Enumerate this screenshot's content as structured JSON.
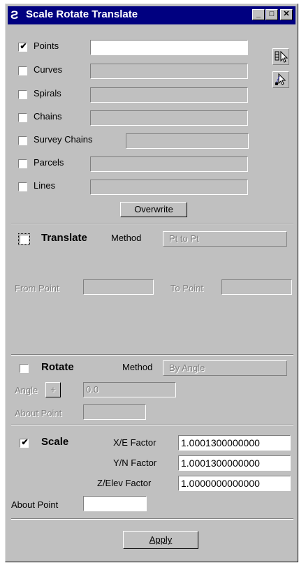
{
  "window": {
    "title": "Scale Rotate Translate"
  },
  "selection": {
    "items": [
      {
        "label": "Points",
        "checked": true,
        "value": ""
      },
      {
        "label": "Curves",
        "checked": false,
        "value": ""
      },
      {
        "label": "Spirals",
        "checked": false,
        "value": ""
      },
      {
        "label": "Chains",
        "checked": false,
        "value": ""
      },
      {
        "label": "Survey Chains",
        "checked": false,
        "value": ""
      },
      {
        "label": "Parcels",
        "checked": false,
        "value": ""
      },
      {
        "label": "Lines",
        "checked": false,
        "value": ""
      }
    ],
    "overwrite_label": "Overwrite"
  },
  "translate": {
    "label": "Translate",
    "checked": false,
    "method_label": "Method",
    "method_value": "Pt to Pt",
    "from_point_label": "From Point",
    "from_point_value": "",
    "to_point_label": "To Point",
    "to_point_value": ""
  },
  "rotate": {
    "label": "Rotate",
    "checked": false,
    "method_label": "Method",
    "method_value": "By Angle",
    "angle_label": "Angle",
    "angle_sign": "+",
    "angle_value": "0.0",
    "about_point_label": "About Point",
    "about_point_value": ""
  },
  "scale": {
    "label": "Scale",
    "checked": true,
    "xe_label": "X/E Factor",
    "xe_value": "1.0001300000000",
    "yn_label": "Y/N Factor",
    "yn_value": "1.0001300000000",
    "ze_label": "Z/Elev Factor",
    "ze_value": "1.0000000000000",
    "about_point_label": "About Point",
    "about_point_value": ""
  },
  "apply_label": "Apply"
}
